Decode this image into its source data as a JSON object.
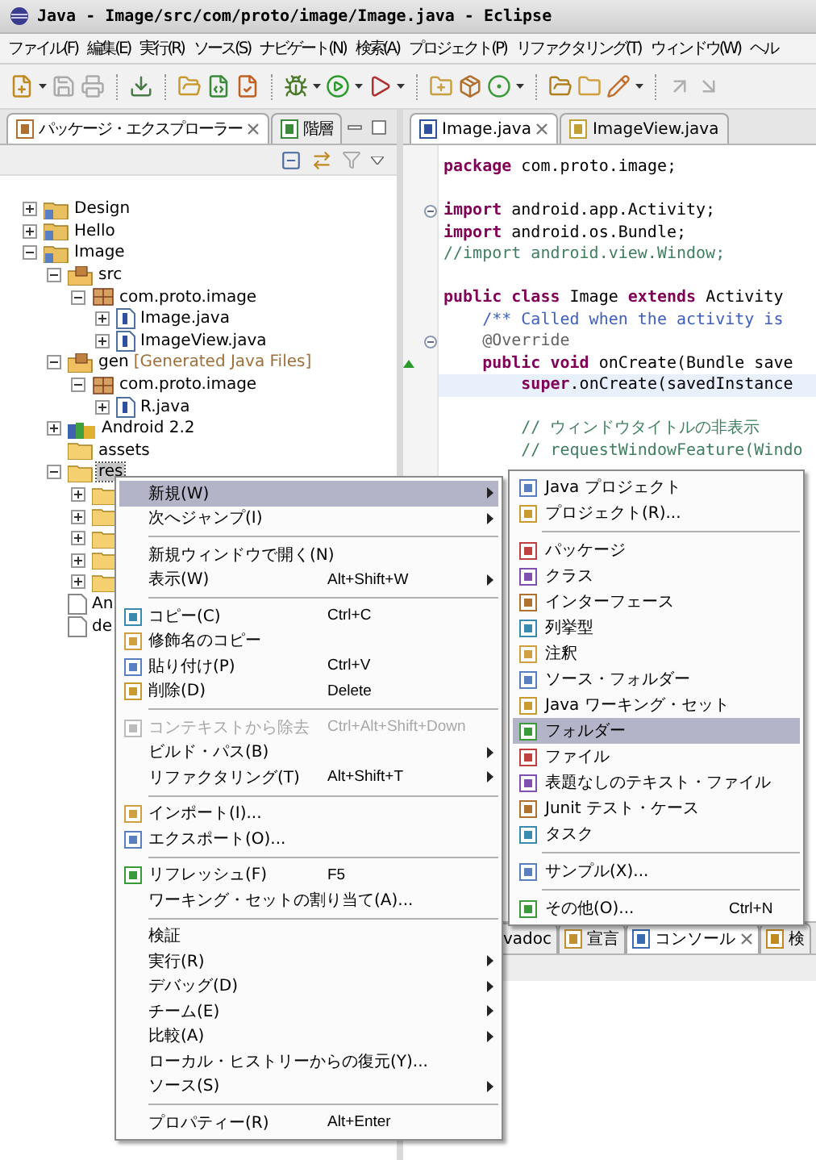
{
  "window": {
    "title": "Java - Image/src/com/proto/image/Image.java - Eclipse"
  },
  "menu_bar": [
    "ファイル(F)",
    "編集(E)",
    "実行(R)",
    "ソース(S)",
    "ナビゲート(N)",
    "検索(A)",
    "プロジェクト(P)",
    "リファクタリング(T)",
    "ウィンドウ(W)",
    "ヘル"
  ],
  "left_panel": {
    "tabs": [
      {
        "label": "パッケージ・エクスプローラー",
        "selected": true,
        "closable": true
      },
      {
        "label": "階層",
        "selected": false,
        "closable": false
      }
    ],
    "tree": [
      {
        "kind": "project",
        "label": "Design",
        "expanded": false,
        "selected": false
      },
      {
        "kind": "project",
        "label": "Hello",
        "expanded": false,
        "selected": false
      },
      {
        "kind": "project",
        "label": "Image",
        "expanded": true,
        "selected": false,
        "children": [
          {
            "kind": "source_folder",
            "label": "src",
            "expanded": true,
            "selected": false,
            "children": [
              {
                "kind": "package",
                "label": "com.proto.image",
                "expanded": true,
                "selected": false,
                "children": [
                  {
                    "kind": "java_file",
                    "label": "Image.java",
                    "expanded": false,
                    "selected": false
                  },
                  {
                    "kind": "java_file",
                    "label": "ImageView.java",
                    "expanded": false,
                    "selected": false
                  }
                ]
              }
            ]
          },
          {
            "kind": "source_folder",
            "label": "gen",
            "suffix": "[Generated Java Files]",
            "expanded": true,
            "selected": false,
            "children": [
              {
                "kind": "package",
                "label": "com.proto.image",
                "expanded": true,
                "selected": false,
                "children": [
                  {
                    "kind": "java_file",
                    "label": "R.java",
                    "expanded": false,
                    "selected": false
                  }
                ]
              }
            ]
          },
          {
            "kind": "library",
            "label": "Android 2.2",
            "expanded": false,
            "selected": false
          },
          {
            "kind": "folder",
            "label": "assets",
            "selected": false
          },
          {
            "kind": "folder",
            "label": "res",
            "expanded": true,
            "selected": true,
            "children": [
              {
                "kind": "folder",
                "expanded": false,
                "selected": false
              },
              {
                "kind": "folder",
                "expanded": false,
                "selected": false
              },
              {
                "kind": "folder",
                "expanded": false,
                "selected": false
              },
              {
                "kind": "folder",
                "expanded": false,
                "selected": false
              },
              {
                "kind": "folder",
                "expanded": false,
                "selected": false
              }
            ]
          },
          {
            "kind": "file",
            "label": "An",
            "selected": false
          },
          {
            "kind": "file",
            "label": "de",
            "selected": false
          }
        ]
      }
    ]
  },
  "editor": {
    "tabs": [
      {
        "label": "Image.java",
        "selected": true,
        "closable": true
      },
      {
        "label": "ImageView.java",
        "selected": false,
        "closable": false
      }
    ],
    "lines": [
      {
        "kind": "code",
        "tokens": [
          {
            "kind": "keyword",
            "text": "package"
          },
          {
            "kind": "plain",
            "text": " com.proto.image;"
          }
        ]
      },
      {
        "kind": "blank"
      },
      {
        "kind": "code",
        "fold_marker": true,
        "tokens": [
          {
            "kind": "keyword",
            "text": "import"
          },
          {
            "kind": "plain",
            "text": " android.app.Activity;"
          }
        ]
      },
      {
        "kind": "code",
        "tokens": [
          {
            "kind": "keyword",
            "text": "import"
          },
          {
            "kind": "plain",
            "text": " android.os.Bundle;"
          }
        ]
      },
      {
        "kind": "code",
        "tokens": [
          {
            "kind": "comment",
            "text": "//import android.view.Window;"
          }
        ]
      },
      {
        "kind": "blank"
      },
      {
        "kind": "code",
        "tokens": [
          {
            "kind": "keyword",
            "text": "public"
          },
          {
            "kind": "keyword",
            "text": " class"
          },
          {
            "kind": "plain",
            "text": " Image "
          },
          {
            "kind": "keyword",
            "text": "extends"
          },
          {
            "kind": "plain",
            "text": " Activity"
          }
        ]
      },
      {
        "kind": "code",
        "tokens": [
          {
            "kind": "javadoc",
            "text": "    /** Called when the activity is"
          }
        ]
      },
      {
        "kind": "code",
        "fold_marker": true,
        "tokens": [
          {
            "kind": "annotation",
            "text": "    @Override"
          }
        ]
      },
      {
        "kind": "code",
        "override_marker": true,
        "tokens": [
          {
            "kind": "keyword",
            "text": "    public"
          },
          {
            "kind": "keyword",
            "text": " void"
          },
          {
            "kind": "plain",
            "text": " onCreate(Bundle save"
          }
        ]
      },
      {
        "kind": "code",
        "highlighted": true,
        "tokens": [
          {
            "kind": "keyword",
            "text": "        super"
          },
          {
            "kind": "plain",
            "text": ".onCreate(savedInstance"
          }
        ]
      },
      {
        "kind": "blank"
      },
      {
        "kind": "code",
        "tokens": [
          {
            "kind": "comment",
            "text": "        // ウィンドウタイトルの非表示"
          }
        ]
      },
      {
        "kind": "code",
        "tokens": [
          {
            "kind": "comment",
            "text": "        // requestWindowFeature(Windo"
          }
        ]
      }
    ]
  },
  "bottom_panel": {
    "tabs": [
      {
        "label": "vadoc",
        "selected": false,
        "closable": false,
        "icon": false
      },
      {
        "label": "宣言",
        "selected": false,
        "closable": false,
        "icon": true
      },
      {
        "label": "コンソール",
        "selected": true,
        "closable": true,
        "icon": true
      },
      {
        "label": "検",
        "selected": false,
        "closable": false,
        "icon": true
      }
    ]
  },
  "context_menu": {
    "items": [
      {
        "kind": "item",
        "label": "新規(W)",
        "selected": true,
        "disabled": false,
        "submenu": true,
        "icon": false
      },
      {
        "kind": "item",
        "label": "次へジャンプ(I)",
        "selected": false,
        "disabled": false,
        "submenu": true,
        "icon": false
      },
      {
        "kind": "separator"
      },
      {
        "kind": "item",
        "label": "新規ウィンドウで開く(N)",
        "selected": false,
        "disabled": false,
        "submenu": false,
        "icon": false
      },
      {
        "kind": "item",
        "label": "表示(W)",
        "shortcut": "Alt+Shift+W",
        "selected": false,
        "disabled": false,
        "submenu": true,
        "icon": false
      },
      {
        "kind": "separator"
      },
      {
        "kind": "item",
        "label": "コピー(C)",
        "shortcut": "Ctrl+C",
        "selected": false,
        "disabled": false,
        "submenu": false,
        "icon": true
      },
      {
        "kind": "item",
        "label": "修飾名のコピー",
        "selected": false,
        "disabled": false,
        "submenu": false,
        "icon": true
      },
      {
        "kind": "item",
        "label": "貼り付け(P)",
        "shortcut": "Ctrl+V",
        "selected": false,
        "disabled": false,
        "submenu": false,
        "icon": true
      },
      {
        "kind": "item",
        "label": "削除(D)",
        "shortcut": "Delete",
        "selected": false,
        "disabled": false,
        "submenu": false,
        "icon": true
      },
      {
        "kind": "separator"
      },
      {
        "kind": "item",
        "label": "コンテキストから除去",
        "shortcut": "Ctrl+Alt+Shift+Down",
        "selected": false,
        "disabled": true,
        "submenu": false,
        "icon": true
      },
      {
        "kind": "item",
        "label": "ビルド・パス(B)",
        "selected": false,
        "disabled": false,
        "submenu": true,
        "icon": false
      },
      {
        "kind": "item",
        "label": "リファクタリング(T)",
        "shortcut": "Alt+Shift+T",
        "selected": false,
        "disabled": false,
        "submenu": true,
        "icon": false
      },
      {
        "kind": "separator"
      },
      {
        "kind": "item",
        "label": "インポート(I)...",
        "selected": false,
        "disabled": false,
        "submenu": false,
        "icon": true
      },
      {
        "kind": "item",
        "label": "エクスポート(O)...",
        "selected": false,
        "disabled": false,
        "submenu": false,
        "icon": true
      },
      {
        "kind": "separator"
      },
      {
        "kind": "item",
        "label": "リフレッシュ(F)",
        "shortcut": "F5",
        "selected": false,
        "disabled": false,
        "submenu": false,
        "icon": true
      },
      {
        "kind": "item",
        "label": "ワーキング・セットの割り当て(A)...",
        "selected": false,
        "disabled": false,
        "submenu": false,
        "icon": false
      },
      {
        "kind": "separator"
      },
      {
        "kind": "item",
        "label": "検証",
        "selected": false,
        "disabled": false,
        "submenu": false,
        "icon": false
      },
      {
        "kind": "item",
        "label": "実行(R)",
        "selected": false,
        "disabled": false,
        "submenu": true,
        "icon": false
      },
      {
        "kind": "item",
        "label": "デバッグ(D)",
        "selected": false,
        "disabled": false,
        "submenu": true,
        "icon": false
      },
      {
        "kind": "item",
        "label": "チーム(E)",
        "selected": false,
        "disabled": false,
        "submenu": true,
        "icon": false
      },
      {
        "kind": "item",
        "label": "比較(A)",
        "selected": false,
        "disabled": false,
        "submenu": true,
        "icon": false
      },
      {
        "kind": "item",
        "label": "ローカル・ヒストリーからの復元(Y)...",
        "selected": false,
        "disabled": false,
        "submenu": false,
        "icon": false
      },
      {
        "kind": "item",
        "label": "ソース(S)",
        "selected": false,
        "disabled": false,
        "submenu": true,
        "icon": false
      },
      {
        "kind": "separator"
      },
      {
        "kind": "item",
        "label": "プロパティー(R)",
        "shortcut": "Alt+Enter",
        "selected": false,
        "disabled": false,
        "submenu": false,
        "icon": false
      }
    ]
  },
  "submenu": {
    "items": [
      {
        "kind": "item",
        "label": "Java プロジェクト",
        "selected": false,
        "icon": true
      },
      {
        "kind": "item",
        "label": "プロジェクト(R)...",
        "selected": false,
        "icon": true
      },
      {
        "kind": "separator"
      },
      {
        "kind": "item",
        "label": "パッケージ",
        "selected": false,
        "icon": true
      },
      {
        "kind": "item",
        "label": "クラス",
        "selected": false,
        "icon": true
      },
      {
        "kind": "item",
        "label": "インターフェース",
        "selected": false,
        "icon": true
      },
      {
        "kind": "item",
        "label": "列挙型",
        "selected": false,
        "icon": true
      },
      {
        "kind": "item",
        "label": "注釈",
        "selected": false,
        "icon": true
      },
      {
        "kind": "item",
        "label": "ソース・フォルダー",
        "selected": false,
        "icon": true
      },
      {
        "kind": "item",
        "label": "Java ワーキング・セット",
        "selected": false,
        "icon": true
      },
      {
        "kind": "item",
        "label": "フォルダー",
        "selected": true,
        "icon": true
      },
      {
        "kind": "item",
        "label": "ファイル",
        "selected": false,
        "icon": true
      },
      {
        "kind": "item",
        "label": "表題なしのテキスト・ファイル",
        "selected": false,
        "icon": true
      },
      {
        "kind": "item",
        "label": "Junit テスト・ケース",
        "selected": false,
        "icon": true
      },
      {
        "kind": "item",
        "label": "タスク",
        "selected": false,
        "icon": true
      },
      {
        "kind": "separator"
      },
      {
        "kind": "item",
        "label": "サンプル(X)...",
        "selected": false,
        "icon": true
      },
      {
        "kind": "separator"
      },
      {
        "kind": "item",
        "label": "その他(O)...",
        "shortcut": "Ctrl+N",
        "selected": false,
        "icon": true
      }
    ]
  }
}
